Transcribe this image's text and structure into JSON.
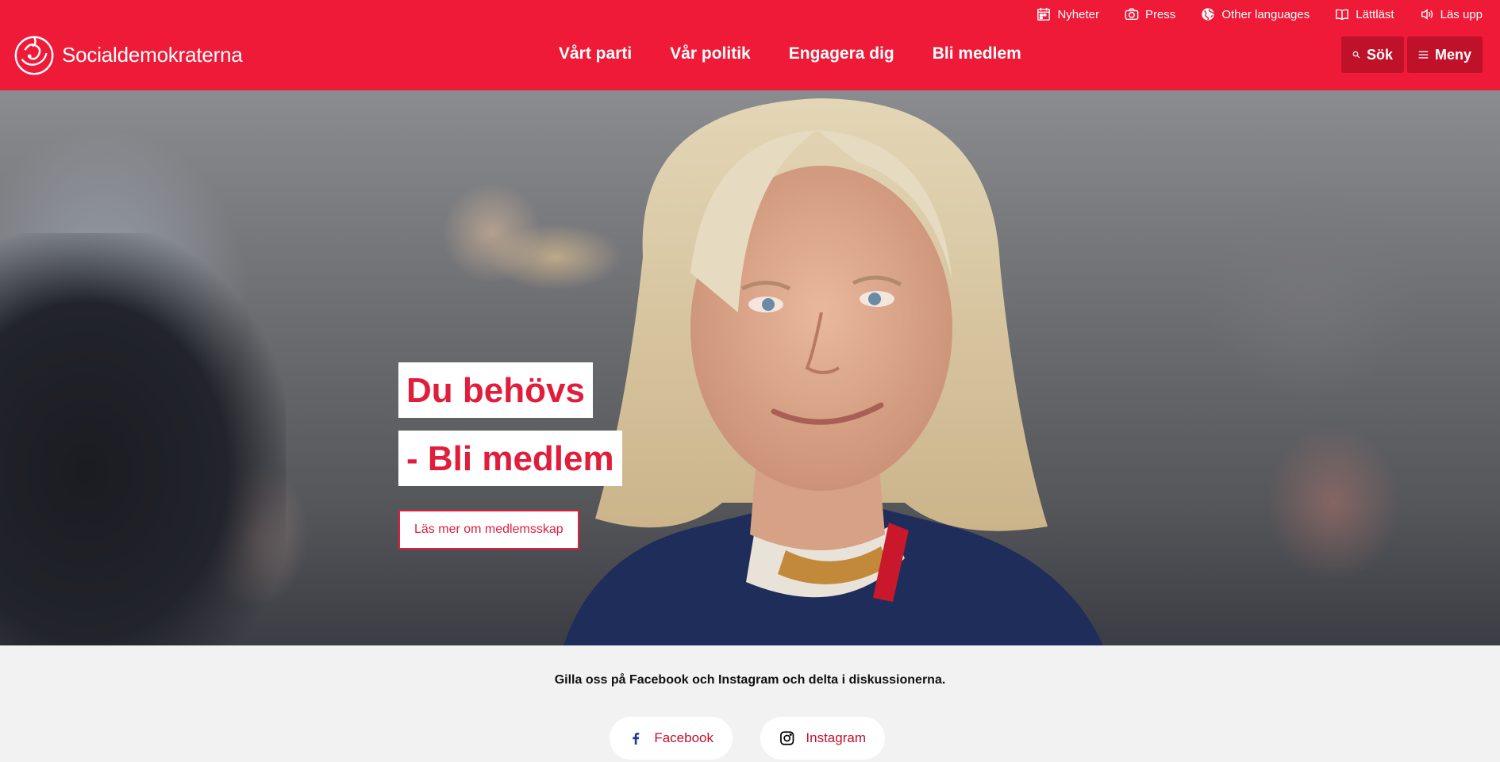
{
  "brand": {
    "name": "Socialdemokraterna",
    "color": "#ee1a37"
  },
  "utility_nav": [
    {
      "label": "Nyheter",
      "icon": "calendar-icon"
    },
    {
      "label": "Press",
      "icon": "camera-icon"
    },
    {
      "label": "Other languages",
      "icon": "globe-icon"
    },
    {
      "label": "Lättläst",
      "icon": "book-icon"
    },
    {
      "label": "Läs upp",
      "icon": "speaker-icon"
    }
  ],
  "main_nav": [
    "Vårt parti",
    "Vår politik",
    "Engagera dig",
    "Bli medlem"
  ],
  "header_buttons": {
    "search": "Sök",
    "menu": "Meny"
  },
  "hero": {
    "line1": "Du behövs",
    "line2": "- Bli medlem",
    "cta": "Läs mer om medlemsskap"
  },
  "social": {
    "text": "Gilla oss på Facebook och Instagram och delta i diskussionerna.",
    "facebook": "Facebook",
    "instagram": "Instagram"
  }
}
